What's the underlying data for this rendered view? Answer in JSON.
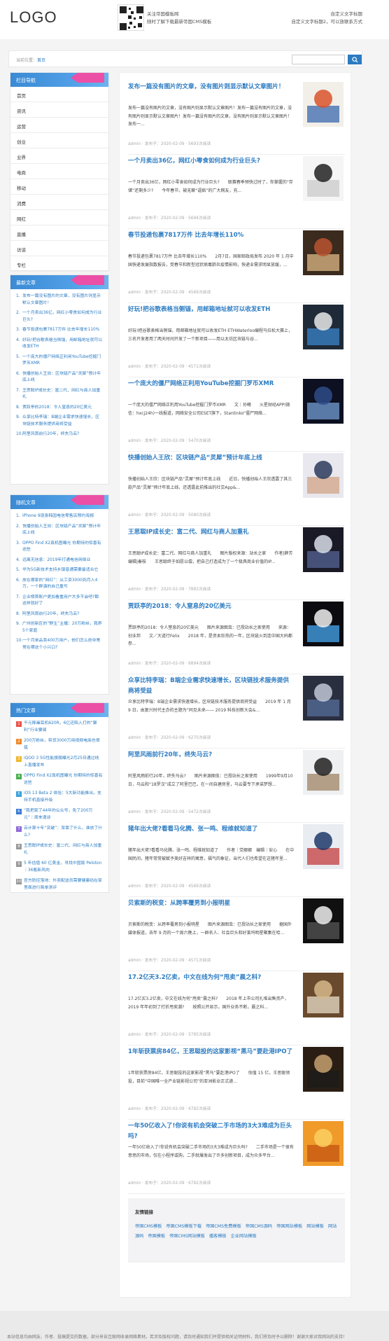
{
  "header": {
    "logo": "LOGO",
    "note_line1": "关注帝国模板网",
    "note_line2": "随时了解下载最新帝国CMS模板",
    "right_line1": "自定义文字标题",
    "right_line2": "自定义文字标题2，可以放联系方式"
  },
  "breadcrumb": {
    "prefix": "当前位置：",
    "home": "首页"
  },
  "search": {
    "placeholder": ""
  },
  "sidebar_nav": {
    "title": "栏目导航",
    "items": [
      "首页",
      "资讯",
      "运营",
      "创业",
      "业界",
      "电商",
      "移动",
      "消费",
      "网红",
      "直播",
      "访谈",
      "专栏"
    ]
  },
  "latest": {
    "title": "最新文章",
    "items": [
      "发布一篇没有图片的文章，没有图片则显示默认文章图片！",
      "一个月卖出36亿，网红小零食如何成为行业巨头?",
      "春节投递包裹7817万件 比去年增长110%",
      "好玩!把谷歌表格当侧锚，用邮箱地址就可以收发ETH",
      "一个庞大的僵尸网络正利用YouTube挖掘门罗币XMR",
      "快播创始人王欣：区块链产品“灵犀”预计年底上线",
      "王思聪IP成长史：富二代、网红与商人加重礼",
      "贾跃亭的2018：令人窒息的20亿美元",
      "众享比特李瑞：B端企业需求快速增长，区块链技术服务提供商将受益",
      "阿里风雨前行20年，终失马云?"
    ]
  },
  "random": {
    "title": "随机文章",
    "items": [
      "iPhone 9现身韩国电信零售店预约海报",
      "快播创始人王欣：区块链产品“灵犀”预计年底上线",
      "OPPO Find X2真机图曝光 你期待的惊喜有这些",
      "远离无信息：2019年打通电信网络业",
      "华为5G新技术支持乡镇普通需要最适合它",
      "放在哪家的“网红”：从工资3000到月入4万，一个群演的自己重写",
      "企业榜首账户更加看重用户大多不会吧?都这样就好了",
      "阿里风雨前行20年，终失马云?",
      "广州创新区的“野生”主播：20万粉丝，我养5个家庭",
      "一个月单品卖400万用户，他们怎么抢夺常常在哪这个小兴口?"
    ]
  },
  "hot": {
    "title": "热门文章",
    "items": [
      "千元降噪耳机620R，6亿还陷入打的“聚利”行业要闻",
      "200万粉丝，带货3000万用视频电商也很猛",
      "iQOO 3 5G性能旗舰曝光2月25日通过线上直播发布",
      "OPPO Find X2真机图曝光 你期待的惊喜有这些",
      "iOS 13 Beta 2 体验：5大新功能推出，支持手机直接升级",
      "“我把家了44年的公众号，免了200万元”｜周末漫谈",
      "云计算十年“突破”：背靠了什么，谁放了什么?",
      "王思聪IP成长史：富二代、网红与商人加重礼",
      "5 年估值 60 亿美金，寻找中国版 Peloton｜36氪新风向",
      "官方防控落地：外卖配送员需要健康码在家里面进行简单测评"
    ],
    "badge_colors": [
      "#e8534a",
      "#f08a2b",
      "#f0b72b",
      "#4caf50",
      "#3aa0d8",
      "#3a7bd5",
      "#8e6cd8",
      "#999999",
      "#999999",
      "#999999"
    ]
  },
  "articles": [
    {
      "title": "发布一篇没有图片的文章，没有图片则显示默认文章图片！",
      "summary": "发布一篇没有图片的文章，没有图片则显示默认文章图片！发布一篇没有图片的文章，没有图片则显示默认文章图片！发布一篇没有图片的文章，没有图片则显示默认文章图片！发布一...",
      "meta": "admin · 发布于：2020-02-09 · 5693次阅读"
    },
    {
      "title": "一个月卖出36亿，网红小零食如何成为行业巨头?",
      "summary": "一个月卖出36亿，网红小零食如何成为行业巨头?　　联赛春季预快过时了，你掌握的&ldquo;存储&rdquo;还剩多少?　　今年春节，被无聊&ldquo;逼疯&rdquo;的广大网友，充...",
      "meta": "admin · 发布于：2020-02-09 · 5694次阅读"
    },
    {
      "title": "春节投递包裹7817万件 比去年增长110%",
      "summary": "春节投递包裹7817万件 比去年增长110%　　2月7日，国家邮政局发布 2020 年 1 月中国快递发展指数报告，受春节和新型冠状病毒肺炎疫情影响，快递业需求明显放缓，...",
      "meta": "admin · 发布于：2020-02-09 · 4569次阅读"
    },
    {
      "title": "好玩!把谷歌表格当侧锚，用邮箱地址就可以收发ETH",
      "summary": "好玩!把谷歌表格当侧锚，用邮箱地址就可以收发ETH ETHWaterloo编程马拉松大赛上，三名开发者用了两天时间开发了一个新项目&mdash;&mdash;用以太坊区块链与谷...",
      "meta": "admin · 发布于：2020-02-09 · 4571次阅读"
    },
    {
      "title": "一个庞大的僵尸网络正利用YouTube挖掘门罗币XMR",
      "summary": "一个庞大的僵尸网络正利用YouTube挖掘门罗币XMR　　文｜孙曦　　火星财经APP(微信：hxcj24h)一线报道，网络安全公司ESET旗下，Stantinko&ldquo;僵尸网络...",
      "meta": "admin · 发布于：2020-02-09 · 5470次阅读"
    },
    {
      "title": "快播创始人王欣：区块链产品“灵犀”预计年底上线",
      "summary": "快播创始人王欣：区块链产品&ldquo;灵犀&rdquo;预计年底上线　　近日，快播创始人王欣透露了其三款产品&ldquo;灵犀&rdquo;预计年底上线，还透露此前推出的社交App&...",
      "meta": "admin · 发布于：2020-02-09 · 5080次阅读"
    },
    {
      "title": "王思聪IP成长史：富二代、网红与商人加重礼",
      "summary": "王思聪IP成长史：富二代、网红与商人加重礼　　图片版权来源：站长之家　　作者|薛芳　　编辑|秦枝　　王思聪终于如愿以偿，把自己打造成为了一个极具商业价值的IP...",
      "meta": "admin · 发布于：2020-02-09 · 7883次阅读"
    },
    {
      "title": "贾跃亭的2018：令人窒息的20亿美元",
      "summary": "贾跃亭的2018：令人窒息的20亿美元　　图片来源图虫：已授站长之家使用　　来源：创业邦　　文／大道行Felix　　2018 年，是资本狂热的一年，区块链火到连中国大妈都参...",
      "meta": "admin · 发布于：2020-02-09 · 6894次阅读"
    },
    {
      "title": "众享比特李瑞：B端企业需求快速增长，区块链技术服务提供商将受益",
      "summary": "众享比特李瑞：B端企业需求快速增长，区块链技术服务提供商将受益　　2019 年 1 月 9 日，由复兴时代主办的主题为&ldquo;同见未来&mdash;&mdash; 2019 科技创新大会&...",
      "meta": "admin · 发布于：2020-02-09 · 6270次阅读"
    },
    {
      "title": "阿里风雨前行20年，终失马云?",
      "summary": "阿里风雨前行20年，终失马云?　　图片来源图虫：已授站长之家使用　　1999年9月10日，马云和&ldquo;18罗汉&rdquo;成立了阿里巴巴，在一间自建房里，马云要专下承诺梦想...",
      "meta": "admin · 发布于：2020-02-09 · 5472次阅读"
    },
    {
      "title": "猪年出大佬?看看马化腾、张一鸣、程维就知道了",
      "summary": "猪年出大佬?看看马化腾、张一鸣、程维就知道了　　作者｜党娜娜　编辑｜安心　　在中国民间，猪年常常被赋予美好吉祥的寓意，福气的象征，当代人们也希望在这猪年里...",
      "meta": "admin · 发布于：2020-02-09 · 4569次阅读"
    },
    {
      "title": "贝索斯的税变：从跨率覆男到小报明星",
      "summary": "贝索斯的税变：从跨率覆男到小报明星　　图片来源图虫：已授站长之家使用　　据国外媒体报道，去年 9 月的一个周六晚上，一群名人、社会巨头和好莱坞明星聚集在哈...",
      "meta": "admin · 发布于：2020-02-09 · 4571次阅读"
    },
    {
      "title": "17.2亿天3.2亿卖，中文在线为何“甩卖”晨之科?",
      "summary": "17.2亿买3.2亿卖，中文在线为何&ldquo;甩卖&rdquo;晨之科?　　2018 年上市公司扎堆出售资产，2019 年年初到了打折甩卖潮?　　按照公开显示，国外业务不断，晨之科...",
      "meta": "admin · 发布于：2020-02-09 · 5785次阅读"
    },
    {
      "title": "1年斩获票房84亿，王思聪投的这家影视“黑马”要赴港IPO了",
      "summary": "1年斩获票房84亿，王思聪投的这家影视&ldquo;黑马&rdquo;要赴港IPO了　　估值 15 亿，王思聪领投，目前&ldquo;中国唯一全产业链影视公司&rdquo;的亚洲影业正式递...",
      "meta": "admin · 发布于：2020-02-09 · 6782次阅读"
    },
    {
      "title": "一年50亿收入了!你说有机会突破二手市场的3大3难成为巨头吗?",
      "summary": "一年50亿收入了!你说有机会突破二手市场的3大3难成为巨头吗?　　二手市场是一个很有意思的市场，仅在小程序或购，二手就爆发出了许多创新项目，成为众多平台...",
      "meta": "admin · 发布于：2020-02-09 · 6782次阅读"
    }
  ],
  "friend_links": {
    "title": "友情链接",
    "items": [
      "帝国CMS模板",
      "帝国CMS模板下载",
      "帝国CMS免费模板",
      "帝国CMS源码",
      "帝国网站模板",
      "网站模板",
      "网站源码",
      "帝国模板",
      "帝国CMS网站模板",
      "播客模板",
      "企业网站模板"
    ]
  },
  "footer": {
    "text": "本站信息均由网友、作者、投稿提交的数据，部分来自互联网收录网络素材。若涉及版权问题，请及时通知我们并提供相关证明材料，我们将及时予以删除！谢谢大家对我网站的支持！"
  },
  "colors": {
    "accent": "#2b7bc2",
    "ribbon": "#ec4fa6"
  }
}
